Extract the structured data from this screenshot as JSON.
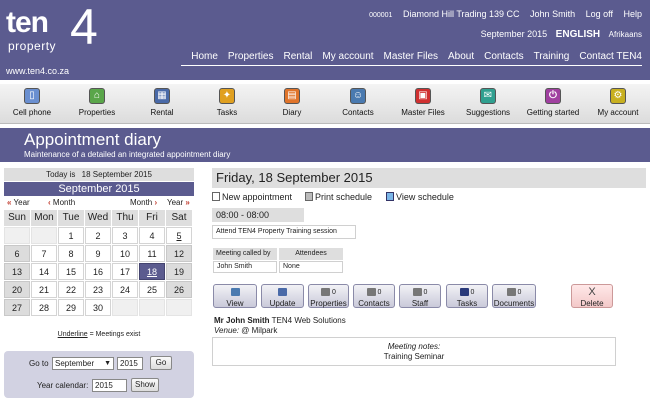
{
  "header": {
    "logo_ten": "ten",
    "logo_four": "4",
    "logo_property": "property",
    "site_url": "www.ten4.co.za",
    "account_id": "000001",
    "company": "Diamond Hill Trading 139 CC",
    "user": "John Smith",
    "logoff": "Log off",
    "help": "Help",
    "current_month": "September 2015",
    "language_active": "ENGLISH",
    "language_other": "Afrikaans"
  },
  "nav": [
    "Home",
    "Properties",
    "Rental",
    "My account",
    "Master Files",
    "About",
    "Contacts",
    "Training",
    "Contact TEN4"
  ],
  "toolbar": [
    {
      "label": "Cell phone",
      "icon": "cell-phone-icon",
      "color": "#6a8fd0"
    },
    {
      "label": "Properties",
      "icon": "properties-icon",
      "color": "#5aa64a"
    },
    {
      "label": "Rental",
      "icon": "rental-icon",
      "color": "#4a6aa8"
    },
    {
      "label": "Tasks",
      "icon": "tasks-icon",
      "color": "#e0a020"
    },
    {
      "label": "Diary",
      "icon": "diary-icon",
      "color": "#e0742a"
    },
    {
      "label": "Contacts",
      "icon": "contacts-icon",
      "color": "#4a7ab0"
    },
    {
      "label": "Master Files",
      "icon": "master-files-icon",
      "color": "#d03030"
    },
    {
      "label": "Suggestions",
      "icon": "suggestions-icon",
      "color": "#30a090"
    },
    {
      "label": "Getting started",
      "icon": "getting-started-icon",
      "color": "#a040a0"
    },
    {
      "label": "My account",
      "icon": "my-account-icon",
      "color": "#c8b020"
    }
  ],
  "page": {
    "title": "Appointment diary",
    "subtitle": "Maintenance of a detailed an integrated appointment diary"
  },
  "calendar": {
    "today_label": "Today is",
    "today_date": "18 September 2015",
    "month_title": "September 2015",
    "prev_year": "Year",
    "prev_month": "Month",
    "next_month": "Month",
    "next_year": "Year",
    "weekdays": [
      "Sun",
      "Mon",
      "Tue",
      "Wed",
      "Thu",
      "Fri",
      "Sat"
    ],
    "weeks": [
      [
        "",
        "",
        "1",
        "2",
        "3",
        "4",
        "5"
      ],
      [
        "6",
        "7",
        "8",
        "9",
        "10",
        "11",
        "12"
      ],
      [
        "13",
        "14",
        "15",
        "16",
        "17",
        "18",
        "19"
      ],
      [
        "20",
        "21",
        "22",
        "23",
        "24",
        "25",
        "26"
      ],
      [
        "27",
        "28",
        "29",
        "30",
        "",
        "",
        ""
      ]
    ],
    "selected_day": "18",
    "underlined_days": [
      "5",
      "18"
    ],
    "legend_underline": "Underline",
    "legend_rest": " = Meetings exist"
  },
  "goto": {
    "label": "Go to",
    "month": "September",
    "year": "2015",
    "go_button": "Go",
    "year_cal_label": "Year calendar:",
    "year_cal_value": "2015",
    "show_button": "Show"
  },
  "day": {
    "heading": "Friday, 18 September 2015",
    "new_appointment": "New appointment",
    "print_schedule": "Print schedule",
    "view_schedule": "View schedule",
    "time": "08:00 - 08:00",
    "description": "Attend TEN4 Property Training session",
    "meeting_called_by_header": "Meeting called by",
    "attendees_header": "Attendees",
    "meeting_called_by": "John Smith",
    "attendees": "None",
    "organizer_name": "Mr John Smith",
    "organizer_company": "TEN4 Web Solutions",
    "venue_label": "Venue:",
    "venue": "@ Milpark",
    "notes_label": "Meeting notes:",
    "notes": "Training Seminar"
  },
  "action_buttons": {
    "view": "View",
    "update": "Update",
    "properties": "Properties",
    "properties_count": "0",
    "contacts": "Contacts",
    "contacts_count": "0",
    "staff": "Staff",
    "staff_count": "0",
    "tasks": "Tasks",
    "tasks_count": "0",
    "documents": "Documents",
    "documents_count": "0",
    "delete_x": "X",
    "delete": "Delete"
  }
}
